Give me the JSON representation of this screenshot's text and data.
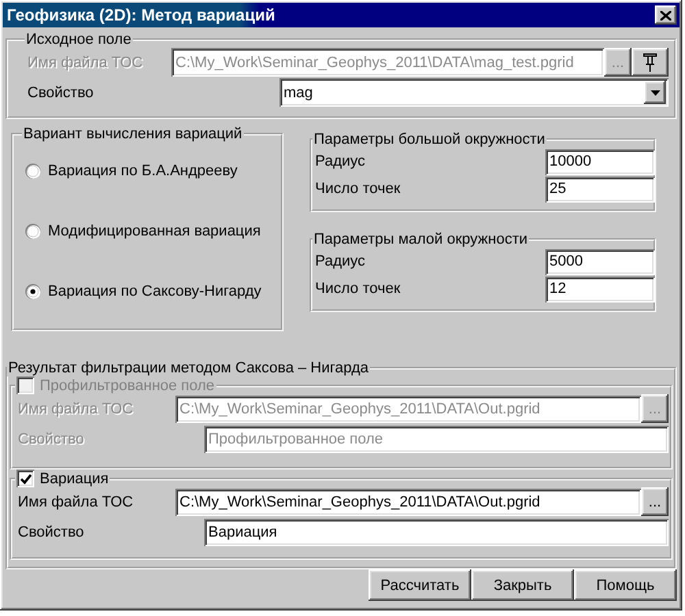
{
  "window": {
    "title": "Геофизика (2D): Метод вариаций"
  },
  "source": {
    "title": "Исходное поле",
    "file": {
      "label": "Имя файла ТОС",
      "value": "C:\\My_Work\\Seminar_Geophys_2011\\DATA\\mag_test.pgrid",
      "disabled": true,
      "browse": "..."
    },
    "property": {
      "label": "Свойство",
      "value": "mag"
    }
  },
  "variant": {
    "title": "Вариант вычисления вариаций",
    "options": [
      {
        "label": "Вариация по Б.А.Андрееву",
        "selected": false
      },
      {
        "label": "Модифицированная вариация",
        "selected": false
      },
      {
        "label": "Вариация по Саксову-Нигарду",
        "selected": true
      }
    ]
  },
  "circles": [
    {
      "title": "Параметры большой окружности",
      "fields": [
        {
          "label": "Радиус",
          "value": "10000"
        },
        {
          "label": "Число точек",
          "value": "25"
        }
      ]
    },
    {
      "title": "Параметры малой окружности",
      "fields": [
        {
          "label": "Радиус",
          "value": "5000"
        },
        {
          "label": "Число точек",
          "value": "12"
        }
      ]
    }
  ],
  "result": {
    "title": "Результат фильтрации методом Саксова – Нигарда",
    "outputs": [
      {
        "title": "Профильтрованное поле",
        "checked": false,
        "disabled": true,
        "file_label": "Имя файла ТОС",
        "file_value": "C:\\My_Work\\Seminar_Geophys_2011\\DATA\\Out.pgrid",
        "browse": "...",
        "property_label": "Свойство",
        "property_value": "Профильтрованное поле"
      },
      {
        "title": "Вариация",
        "checked": true,
        "disabled": false,
        "file_label": "Имя файла ТОС",
        "file_value": "C:\\My_Work\\Seminar_Geophys_2011\\DATA\\Out.pgrid",
        "browse": "...",
        "property_label": "Свойство",
        "property_value": "Вариация"
      }
    ]
  },
  "buttons": [
    "Рассчитать",
    "Закрыть",
    "Помощь"
  ]
}
